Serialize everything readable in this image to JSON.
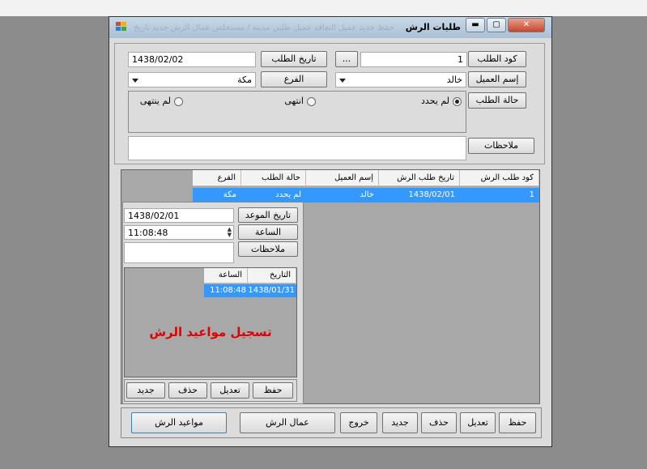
{
  "window": {
    "title": "طلبات الرش",
    "min": "▬",
    "max": "▢",
    "close": "✕"
  },
  "ghost_menu": "حفظ   جديد   عميل التعاقد   عميل طلبي   مدينة / مستخلص   عمال الرش   جديد   تاريخ",
  "header": {
    "code_label": "كود الطلب",
    "code_value": "1",
    "browse_label": "...",
    "date_label": "تاريخ الطلب",
    "date_value": "1438/02/02",
    "customer_label": "إسم العميل",
    "customer_value": "خالد",
    "branch_label": "الفرع",
    "branch_value": "مكة",
    "status_label": "حالة الطلب",
    "status_options": [
      "لم يحدد",
      "انتهى",
      "لم ينتهى"
    ],
    "status_selected": "لم يحدد",
    "notes_label": "ملاحظات",
    "notes_value": ""
  },
  "orders_grid": {
    "columns": [
      "كود طلب الرش",
      "تاريخ طلب الرش",
      "إسم العميل",
      "حالة الطلب",
      "الفرع"
    ],
    "rows": [
      [
        "1",
        "1438/02/01",
        "خالد",
        "لم يحدد",
        "مكة"
      ]
    ]
  },
  "appointments": {
    "date_label": "تاريخ الموعد",
    "date_value": "1438/02/01",
    "time_label": "الساعة",
    "time_value": "11:08:48",
    "notes_label": "ملاحظات",
    "notes_value": "",
    "grid_columns": [
      "التاريخ",
      "الساعة"
    ],
    "grid_rows": [
      [
        "1438/01/31",
        "11:08:48"
      ]
    ],
    "banner": "تسجيل مواعيد الرش",
    "save": "حفظ",
    "edit": "تعديل",
    "delete": "حذف",
    "new": "جديد"
  },
  "footer": {
    "save": "حفظ",
    "edit": "تعديل",
    "delete": "حذف",
    "new": "جديد",
    "exit": "خروج",
    "workers": "عمال الرش",
    "appointments": "مواعيد الرش"
  }
}
